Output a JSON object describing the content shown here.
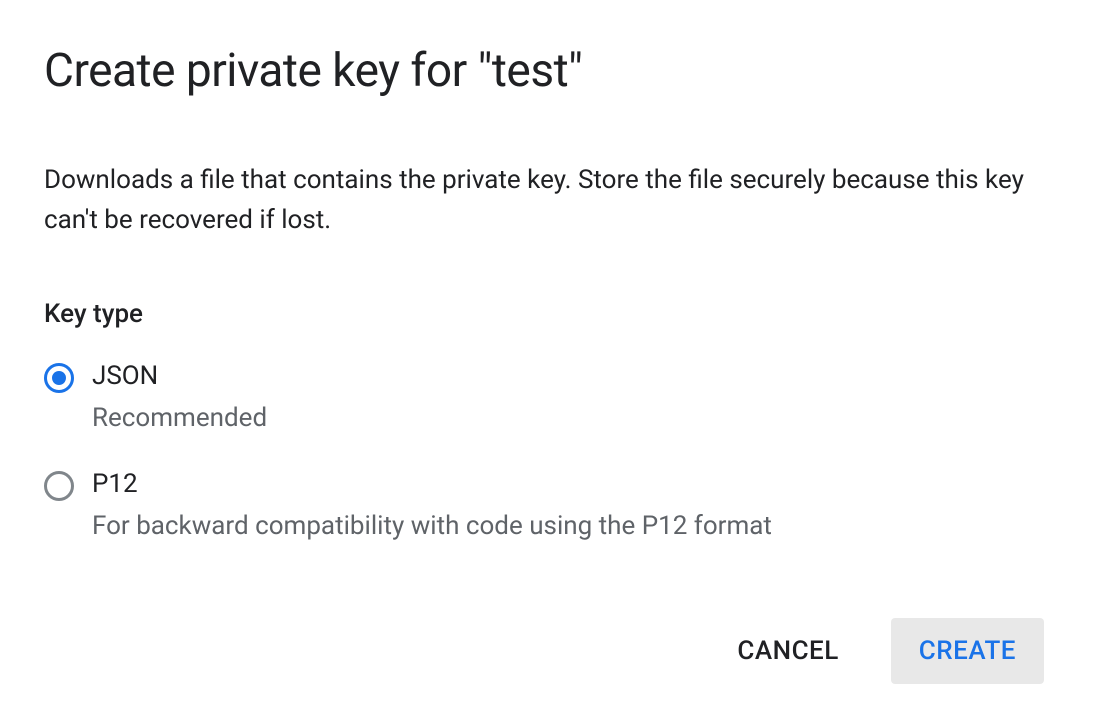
{
  "dialog": {
    "title": "Create private key for \"test\"",
    "description": "Downloads a file that contains the private key. Store the file securely because this key can't be recovered if lost.",
    "section_label": "Key type",
    "options": [
      {
        "label": "JSON",
        "subtitle": "Recommended",
        "selected": true
      },
      {
        "label": "P12",
        "subtitle": "For backward compatibility with code using the P12 format",
        "selected": false
      }
    ],
    "actions": {
      "cancel": "CANCEL",
      "create": "CREATE"
    }
  }
}
